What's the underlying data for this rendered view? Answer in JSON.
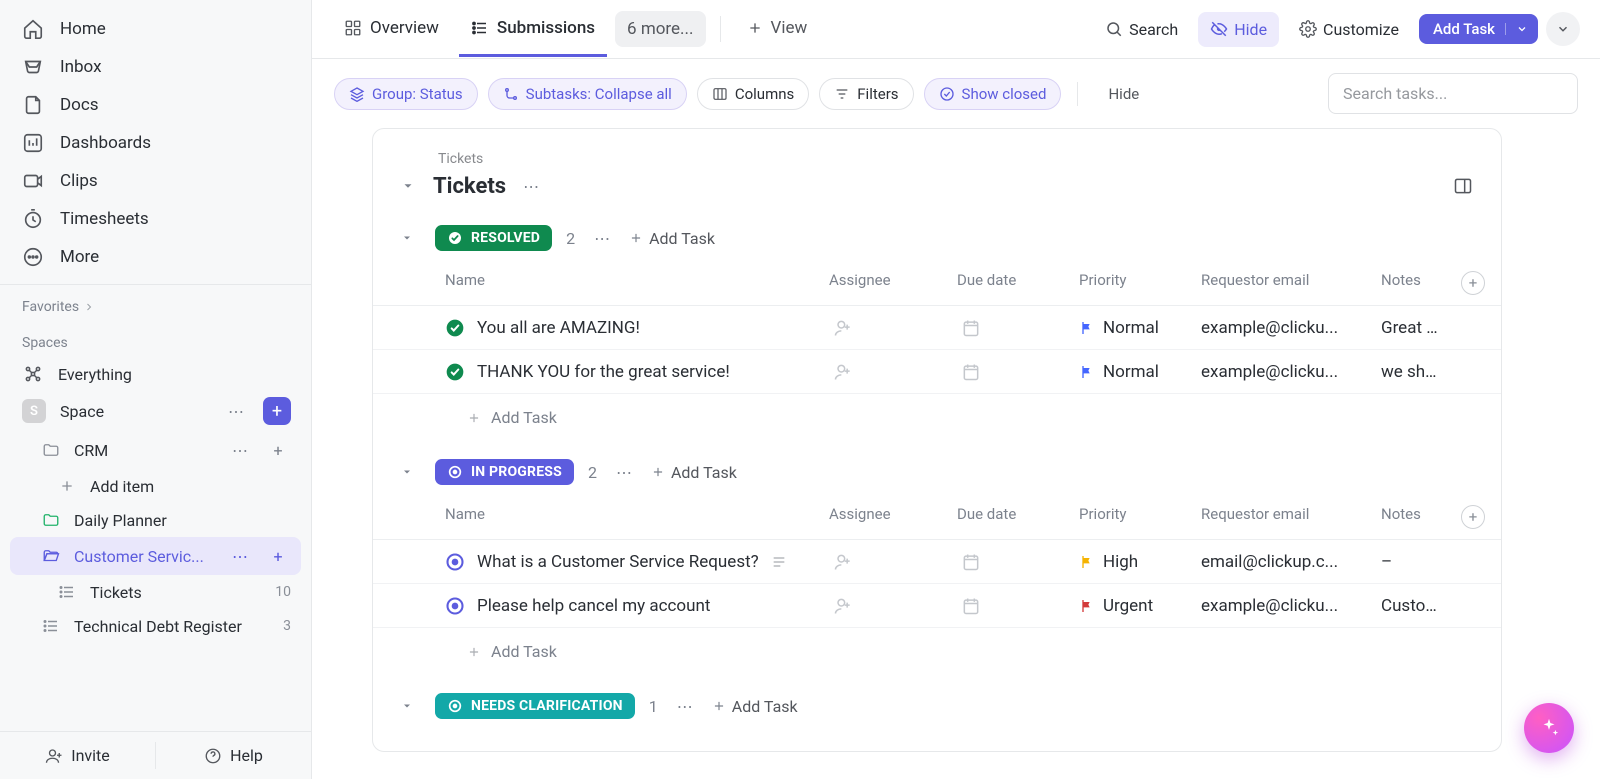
{
  "sidebar": {
    "nav": [
      {
        "label": "Home"
      },
      {
        "label": "Inbox"
      },
      {
        "label": "Docs"
      },
      {
        "label": "Dashboards"
      },
      {
        "label": "Clips"
      },
      {
        "label": "Timesheets"
      },
      {
        "label": "More"
      }
    ],
    "favorites_label": "Favorites",
    "spaces_label": "Spaces",
    "everything": "Everything",
    "space_name": "Space",
    "crm": "CRM",
    "add_item": "Add item",
    "daily_planner": "Daily Planner",
    "customer_service": "Customer Servic...",
    "tickets": "Tickets",
    "tickets_count": "10",
    "tech_debt": "Technical Debt Register",
    "tech_debt_count": "3",
    "invite": "Invite",
    "help": "Help"
  },
  "tabs": {
    "overview": "Overview",
    "submissions": "Submissions",
    "more": "6 more...",
    "view": "View",
    "search": "Search",
    "hide": "Hide",
    "customize": "Customize",
    "add_task": "Add Task"
  },
  "filters": {
    "group": "Group: Status",
    "subtasks": "Subtasks: Collapse all",
    "columns": "Columns",
    "filters": "Filters",
    "show_closed": "Show closed",
    "hide": "Hide",
    "search_placeholder": "Search tasks..."
  },
  "list": {
    "crumb": "Tickets",
    "title": "Tickets",
    "columns": {
      "name": "Name",
      "assignee": "Assignee",
      "due": "Due date",
      "priority": "Priority",
      "email": "Requestor email",
      "notes": "Notes"
    },
    "add_task": "Add Task",
    "groups": [
      {
        "status": "RESOLVED",
        "color": "#0f8a4f",
        "count": "2",
        "rows": [
          {
            "name": "You all are AMAZING!",
            "priority": "Normal",
            "pri_color": "#4466ff",
            "email": "example@clicku...",
            "notes": "Great cust",
            "status_kind": "check"
          },
          {
            "name": "THANK YOU for the great service!",
            "priority": "Normal",
            "pri_color": "#4466ff",
            "email": "example@clicku...",
            "notes": "we should",
            "status_kind": "check"
          }
        ]
      },
      {
        "status": "IN PROGRESS",
        "color": "#5c5cde",
        "count": "2",
        "rows": [
          {
            "name": "What is a Customer Service Request?",
            "priority": "High",
            "pri_color": "#f5b300",
            "email": "email@clickup.c...",
            "notes": "–",
            "status_kind": "ring",
            "has_desc": true
          },
          {
            "name": "Please help cancel my account",
            "priority": "Urgent",
            "pri_color": "#d33a3a",
            "email": "example@clicku...",
            "notes": "Customer",
            "status_kind": "ring"
          }
        ]
      },
      {
        "status": "NEEDS CLARIFICATION",
        "color": "#13a8a8",
        "count": "1",
        "rows": []
      }
    ]
  }
}
